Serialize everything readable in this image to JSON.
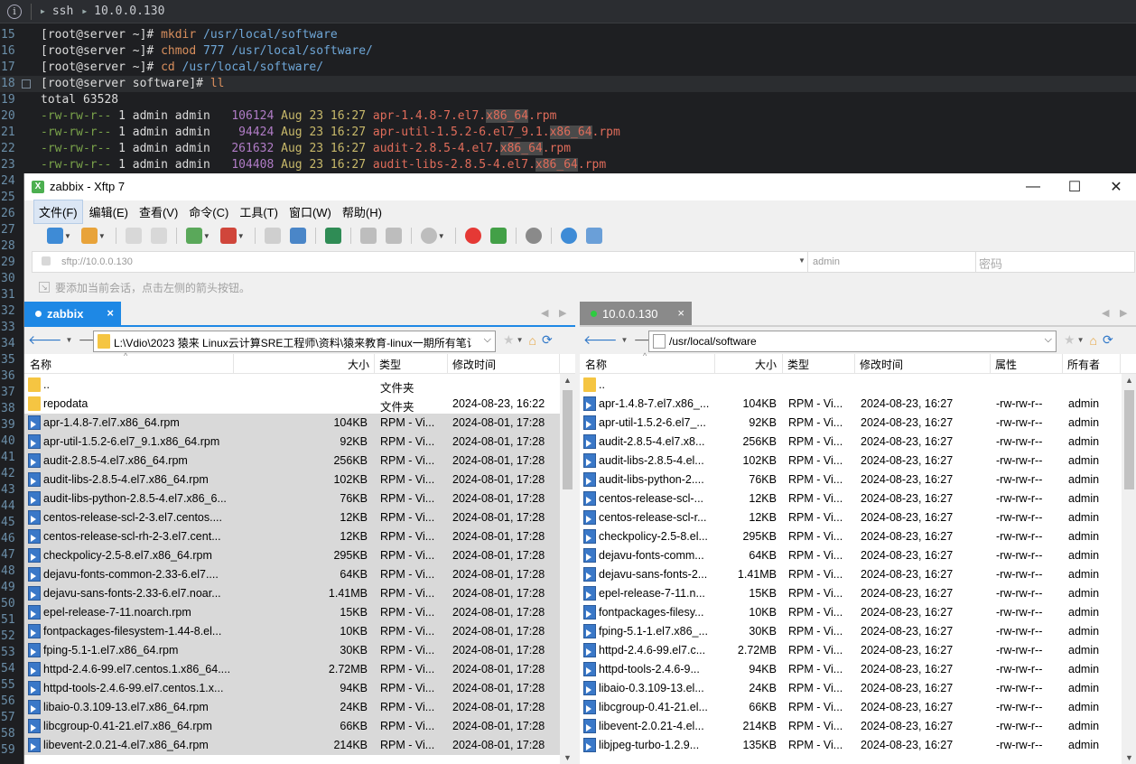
{
  "term_header": {
    "crumb1": "ssh",
    "crumb2": "10.0.0.130"
  },
  "terminal_lines": [
    {
      "n": "15",
      "prompt": "[root@server ~]# ",
      "cmd": "mkdir",
      "arg": " /usr/local/software"
    },
    {
      "n": "16",
      "prompt": "[root@server ~]# ",
      "cmd": "chmod",
      "arg": " 777 /usr/local/software/"
    },
    {
      "n": "17",
      "prompt": "[root@server ~]# ",
      "cmd": "cd",
      "arg": " /usr/local/software/"
    },
    {
      "n": "18",
      "prompt": "[root@server software]# ",
      "cmd": "ll",
      "arg": ""
    },
    {
      "n": "19",
      "plain": "total 63528"
    },
    {
      "n": "20",
      "perm": "-rw-rw-r--",
      "mid": " 1 admin admin ",
      "size": "  106124",
      "date": " Aug 23 16:27 ",
      "f1": "apr-1.4.8-7.el7.",
      "hl": "x86_64",
      "f2": ".rpm"
    },
    {
      "n": "21",
      "perm": "-rw-rw-r--",
      "mid": " 1 admin admin ",
      "size": "   94424",
      "date": " Aug 23 16:27 ",
      "f1": "apr-util-1.5.2-6.el7_9.1.",
      "hl": "x86_64",
      "f2": ".rpm"
    },
    {
      "n": "22",
      "perm": "-rw-rw-r--",
      "mid": " 1 admin admin ",
      "size": "  261632",
      "date": " Aug 23 16:27 ",
      "f1": "audit-2.8.5-4.el7.",
      "hl": "x86_64",
      "f2": ".rpm"
    },
    {
      "n": "23",
      "perm": "-rw-rw-r--",
      "mid": " 1 admin admin ",
      "size": "  104408",
      "date": " Aug 23 16:27 ",
      "f1": "audit-libs-2.8.5-4.el7.",
      "hl": "x86_64",
      "f2": ".rpm"
    }
  ],
  "gutter_numbers": [
    "24",
    "25",
    "26",
    "27",
    "28",
    "29",
    "30",
    "31",
    "32",
    "33",
    "34",
    "35",
    "36",
    "37",
    "38",
    "39",
    "40",
    "41",
    "42",
    "43",
    "44",
    "45",
    "46",
    "47",
    "48",
    "49",
    "50",
    "51",
    "52",
    "53",
    "54",
    "55",
    "56",
    "57",
    "58",
    "59"
  ],
  "window": {
    "title": "zabbix - Xftp 7",
    "app_icon": "X",
    "minimize": "—",
    "maximize": "☐",
    "close": "✕"
  },
  "menu": [
    "文件(F)",
    "编辑(E)",
    "查看(V)",
    "命令(C)",
    "工具(T)",
    "窗口(W)",
    "帮助(H)"
  ],
  "address": {
    "url": "sftp://10.0.0.130",
    "user": "admin",
    "password_placeholder": "密码"
  },
  "hint": "要添加当前会话，点击左侧的箭头按钮。",
  "left_pane": {
    "tab_label": "zabbix",
    "tab_close": "×",
    "path": "L:\\Vdio\\2023 猿来 Linux云计算SRE工程师\\资料\\猿来教育-linux一期所有笔记",
    "headers": {
      "name": "名称",
      "size": "大小",
      "type": "类型",
      "modified": "修改时间"
    },
    "rows": [
      {
        "name": "..",
        "size": "",
        "type": "文件夹",
        "mod": "",
        "kind": "folder",
        "sel": false
      },
      {
        "name": "repodata",
        "size": "",
        "type": "文件夹",
        "mod": "2024-08-23, 16:22",
        "kind": "folder",
        "sel": false
      },
      {
        "name": "apr-1.4.8-7.el7.x86_64.rpm",
        "size": "104KB",
        "type": "RPM - Vi...",
        "mod": "2024-08-01, 17:28",
        "kind": "file",
        "sel": true
      },
      {
        "name": "apr-util-1.5.2-6.el7_9.1.x86_64.rpm",
        "size": "92KB",
        "type": "RPM - Vi...",
        "mod": "2024-08-01, 17:28",
        "kind": "file",
        "sel": true
      },
      {
        "name": "audit-2.8.5-4.el7.x86_64.rpm",
        "size": "256KB",
        "type": "RPM - Vi...",
        "mod": "2024-08-01, 17:28",
        "kind": "file",
        "sel": true
      },
      {
        "name": "audit-libs-2.8.5-4.el7.x86_64.rpm",
        "size": "102KB",
        "type": "RPM - Vi...",
        "mod": "2024-08-01, 17:28",
        "kind": "file",
        "sel": true
      },
      {
        "name": "audit-libs-python-2.8.5-4.el7.x86_6...",
        "size": "76KB",
        "type": "RPM - Vi...",
        "mod": "2024-08-01, 17:28",
        "kind": "file",
        "sel": true
      },
      {
        "name": "centos-release-scl-2-3.el7.centos....",
        "size": "12KB",
        "type": "RPM - Vi...",
        "mod": "2024-08-01, 17:28",
        "kind": "file",
        "sel": true
      },
      {
        "name": "centos-release-scl-rh-2-3.el7.cent...",
        "size": "12KB",
        "type": "RPM - Vi...",
        "mod": "2024-08-01, 17:28",
        "kind": "file",
        "sel": true
      },
      {
        "name": "checkpolicy-2.5-8.el7.x86_64.rpm",
        "size": "295KB",
        "type": "RPM - Vi...",
        "mod": "2024-08-01, 17:28",
        "kind": "file",
        "sel": true
      },
      {
        "name": "dejavu-fonts-common-2.33-6.el7....",
        "size": "64KB",
        "type": "RPM - Vi...",
        "mod": "2024-08-01, 17:28",
        "kind": "file",
        "sel": true
      },
      {
        "name": "dejavu-sans-fonts-2.33-6.el7.noar...",
        "size": "1.41MB",
        "type": "RPM - Vi...",
        "mod": "2024-08-01, 17:28",
        "kind": "file",
        "sel": true
      },
      {
        "name": "epel-release-7-11.noarch.rpm",
        "size": "15KB",
        "type": "RPM - Vi...",
        "mod": "2024-08-01, 17:28",
        "kind": "file",
        "sel": true
      },
      {
        "name": "fontpackages-filesystem-1.44-8.el...",
        "size": "10KB",
        "type": "RPM - Vi...",
        "mod": "2024-08-01, 17:28",
        "kind": "file",
        "sel": true
      },
      {
        "name": "fping-5.1-1.el7.x86_64.rpm",
        "size": "30KB",
        "type": "RPM - Vi...",
        "mod": "2024-08-01, 17:28",
        "kind": "file",
        "sel": true
      },
      {
        "name": "httpd-2.4.6-99.el7.centos.1.x86_64....",
        "size": "2.72MB",
        "type": "RPM - Vi...",
        "mod": "2024-08-01, 17:28",
        "kind": "file",
        "sel": true
      },
      {
        "name": "httpd-tools-2.4.6-99.el7.centos.1.x...",
        "size": "94KB",
        "type": "RPM - Vi...",
        "mod": "2024-08-01, 17:28",
        "kind": "file",
        "sel": true
      },
      {
        "name": "libaio-0.3.109-13.el7.x86_64.rpm",
        "size": "24KB",
        "type": "RPM - Vi...",
        "mod": "2024-08-01, 17:28",
        "kind": "file",
        "sel": true
      },
      {
        "name": "libcgroup-0.41-21.el7.x86_64.rpm",
        "size": "66KB",
        "type": "RPM - Vi...",
        "mod": "2024-08-01, 17:28",
        "kind": "file",
        "sel": true
      },
      {
        "name": "libevent-2.0.21-4.el7.x86_64.rpm",
        "size": "214KB",
        "type": "RPM - Vi...",
        "mod": "2024-08-01, 17:28",
        "kind": "file",
        "sel": true
      }
    ]
  },
  "right_pane": {
    "tab_label": "10.0.0.130",
    "tab_close": "×",
    "path": "/usr/local/software",
    "headers": {
      "name": "名称",
      "size": "大小",
      "type": "类型",
      "modified": "修改时间",
      "attr": "属性",
      "owner": "所有者"
    },
    "rows": [
      {
        "name": "..",
        "size": "",
        "type": "",
        "mod": "",
        "attr": "",
        "owner": "",
        "kind": "folder"
      },
      {
        "name": "apr-1.4.8-7.el7.x86_...",
        "size": "104KB",
        "type": "RPM - Vi...",
        "mod": "2024-08-23, 16:27",
        "attr": "-rw-rw-r--",
        "owner": "admin",
        "kind": "file"
      },
      {
        "name": "apr-util-1.5.2-6.el7_...",
        "size": "92KB",
        "type": "RPM - Vi...",
        "mod": "2024-08-23, 16:27",
        "attr": "-rw-rw-r--",
        "owner": "admin",
        "kind": "file"
      },
      {
        "name": "audit-2.8.5-4.el7.x8...",
        "size": "256KB",
        "type": "RPM - Vi...",
        "mod": "2024-08-23, 16:27",
        "attr": "-rw-rw-r--",
        "owner": "admin",
        "kind": "file"
      },
      {
        "name": "audit-libs-2.8.5-4.el...",
        "size": "102KB",
        "type": "RPM - Vi...",
        "mod": "2024-08-23, 16:27",
        "attr": "-rw-rw-r--",
        "owner": "admin",
        "kind": "file"
      },
      {
        "name": "audit-libs-python-2....",
        "size": "76KB",
        "type": "RPM - Vi...",
        "mod": "2024-08-23, 16:27",
        "attr": "-rw-rw-r--",
        "owner": "admin",
        "kind": "file"
      },
      {
        "name": "centos-release-scl-...",
        "size": "12KB",
        "type": "RPM - Vi...",
        "mod": "2024-08-23, 16:27",
        "attr": "-rw-rw-r--",
        "owner": "admin",
        "kind": "file"
      },
      {
        "name": "centos-release-scl-r...",
        "size": "12KB",
        "type": "RPM - Vi...",
        "mod": "2024-08-23, 16:27",
        "attr": "-rw-rw-r--",
        "owner": "admin",
        "kind": "file"
      },
      {
        "name": "checkpolicy-2.5-8.el...",
        "size": "295KB",
        "type": "RPM - Vi...",
        "mod": "2024-08-23, 16:27",
        "attr": "-rw-rw-r--",
        "owner": "admin",
        "kind": "file"
      },
      {
        "name": "dejavu-fonts-comm...",
        "size": "64KB",
        "type": "RPM - Vi...",
        "mod": "2024-08-23, 16:27",
        "attr": "-rw-rw-r--",
        "owner": "admin",
        "kind": "file"
      },
      {
        "name": "dejavu-sans-fonts-2...",
        "size": "1.41MB",
        "type": "RPM - Vi...",
        "mod": "2024-08-23, 16:27",
        "attr": "-rw-rw-r--",
        "owner": "admin",
        "kind": "file"
      },
      {
        "name": "epel-release-7-11.n...",
        "size": "15KB",
        "type": "RPM - Vi...",
        "mod": "2024-08-23, 16:27",
        "attr": "-rw-rw-r--",
        "owner": "admin",
        "kind": "file"
      },
      {
        "name": "fontpackages-filesy...",
        "size": "10KB",
        "type": "RPM - Vi...",
        "mod": "2024-08-23, 16:27",
        "attr": "-rw-rw-r--",
        "owner": "admin",
        "kind": "file"
      },
      {
        "name": "fping-5.1-1.el7.x86_...",
        "size": "30KB",
        "type": "RPM - Vi...",
        "mod": "2024-08-23, 16:27",
        "attr": "-rw-rw-r--",
        "owner": "admin",
        "kind": "file"
      },
      {
        "name": "httpd-2.4.6-99.el7.c...",
        "size": "2.72MB",
        "type": "RPM - Vi...",
        "mod": "2024-08-23, 16:27",
        "attr": "-rw-rw-r--",
        "owner": "admin",
        "kind": "file"
      },
      {
        "name": "httpd-tools-2.4.6-9...",
        "size": "94KB",
        "type": "RPM - Vi...",
        "mod": "2024-08-23, 16:27",
        "attr": "-rw-rw-r--",
        "owner": "admin",
        "kind": "file"
      },
      {
        "name": "libaio-0.3.109-13.el...",
        "size": "24KB",
        "type": "RPM - Vi...",
        "mod": "2024-08-23, 16:27",
        "attr": "-rw-rw-r--",
        "owner": "admin",
        "kind": "file"
      },
      {
        "name": "libcgroup-0.41-21.el...",
        "size": "66KB",
        "type": "RPM - Vi...",
        "mod": "2024-08-23, 16:27",
        "attr": "-rw-rw-r--",
        "owner": "admin",
        "kind": "file"
      },
      {
        "name": "libevent-2.0.21-4.el...",
        "size": "214KB",
        "type": "RPM - Vi...",
        "mod": "2024-08-23, 16:27",
        "attr": "-rw-rw-r--",
        "owner": "admin",
        "kind": "file"
      },
      {
        "name": "libjpeg-turbo-1.2.9...",
        "size": "135KB",
        "type": "RPM - Vi...",
        "mod": "2024-08-23, 16:27",
        "attr": "-rw-rw-r--",
        "owner": "admin",
        "kind": "file"
      }
    ]
  }
}
